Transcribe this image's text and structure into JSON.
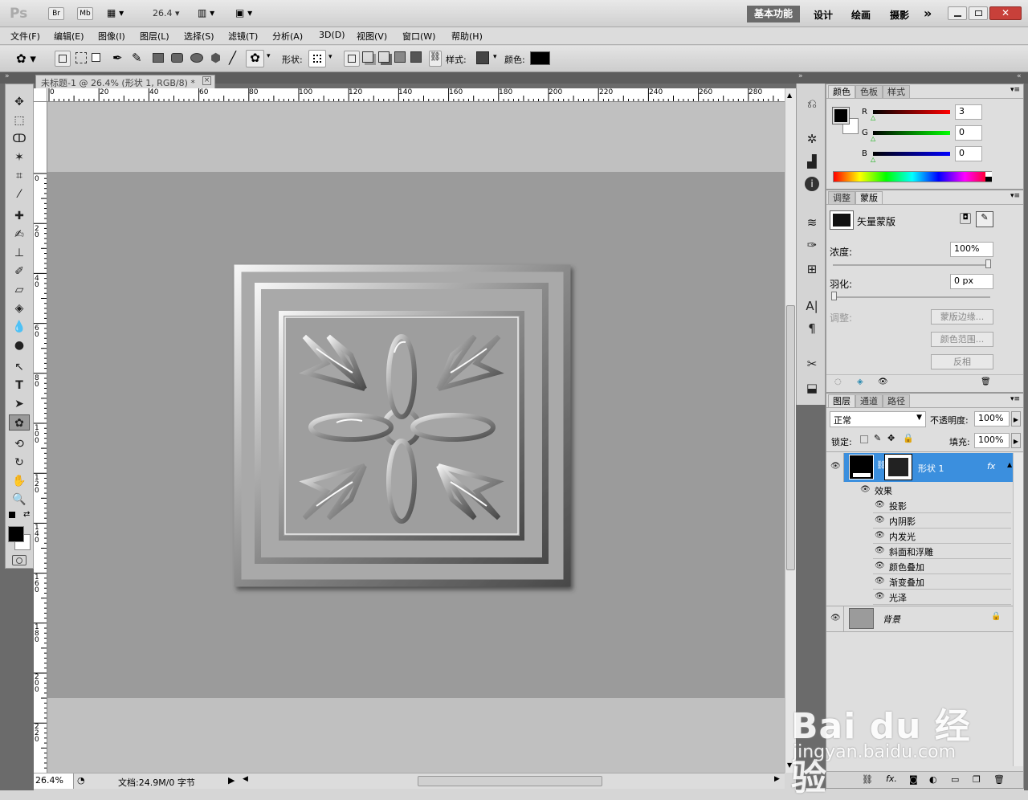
{
  "appbar": {
    "logo": "Ps",
    "bridge": "Br",
    "minibridge": "Mb",
    "zoom": "26.4",
    "workspace_active": "基本功能",
    "workspace_design": "设计",
    "workspace_paint": "绘画",
    "workspace_photo": "摄影",
    "more": "»"
  },
  "menu": [
    "文件(F)",
    "编辑(E)",
    "图像(I)",
    "图层(L)",
    "选择(S)",
    "滤镜(T)",
    "分析(A)",
    "3D(D)",
    "视图(V)",
    "窗口(W)",
    "帮助(H)"
  ],
  "options": {
    "shape_label": "形状:",
    "style_label": "样式:",
    "color_label": "颜色:",
    "color_value": "#000000"
  },
  "document": {
    "tab_title": "未标题-1 @ 26.4% (形状 1, RGB/8) *",
    "close": "×"
  },
  "ruler": {
    "top": [
      "0",
      "20",
      "40",
      "60",
      "80",
      "100",
      "120",
      "140",
      "160",
      "180",
      "200",
      "220",
      "240",
      "260",
      "280"
    ],
    "left": [
      "0",
      "2 0",
      "4 0",
      "6 0",
      "8 0",
      "1 0 0",
      "1 2 0",
      "1 4 0",
      "1 6 0",
      "1 8 0",
      "2 0 0",
      "2 2 0"
    ]
  },
  "status": {
    "zoom": "26.4%",
    "doc": "文档:24.9M/0 字节"
  },
  "color_panel": {
    "tabs": [
      "颜色",
      "色板",
      "样式"
    ],
    "r_label": "R",
    "g_label": "G",
    "b_label": "B",
    "r": "3",
    "g": "0",
    "b": "0"
  },
  "mask_panel": {
    "tabs": [
      "调整",
      "蒙版"
    ],
    "title": "矢量蒙版",
    "density_label": "浓度:",
    "density": "100%",
    "feather_label": "羽化:",
    "feather": "0 px",
    "refine_label": "调整:",
    "btn_edge": "蒙版边缘...",
    "btn_range": "颜色范围...",
    "btn_invert": "反相"
  },
  "layers_panel": {
    "tabs": [
      "图层",
      "通道",
      "路径"
    ],
    "blend": "正常",
    "opacity_label": "不透明度:",
    "opacity": "100%",
    "lock_label": "锁定:",
    "fill_label": "填充:",
    "fill": "100%",
    "layer1": "形状 1",
    "effects_label": "效果",
    "effects": [
      "投影",
      "内阴影",
      "内发光",
      "斜面和浮雕",
      "颜色叠加",
      "渐变叠加",
      "光泽"
    ],
    "background": "背景",
    "fx": "fx"
  },
  "watermark": {
    "brand": "Bai du 经验",
    "url": "jingyan.baidu.com"
  }
}
